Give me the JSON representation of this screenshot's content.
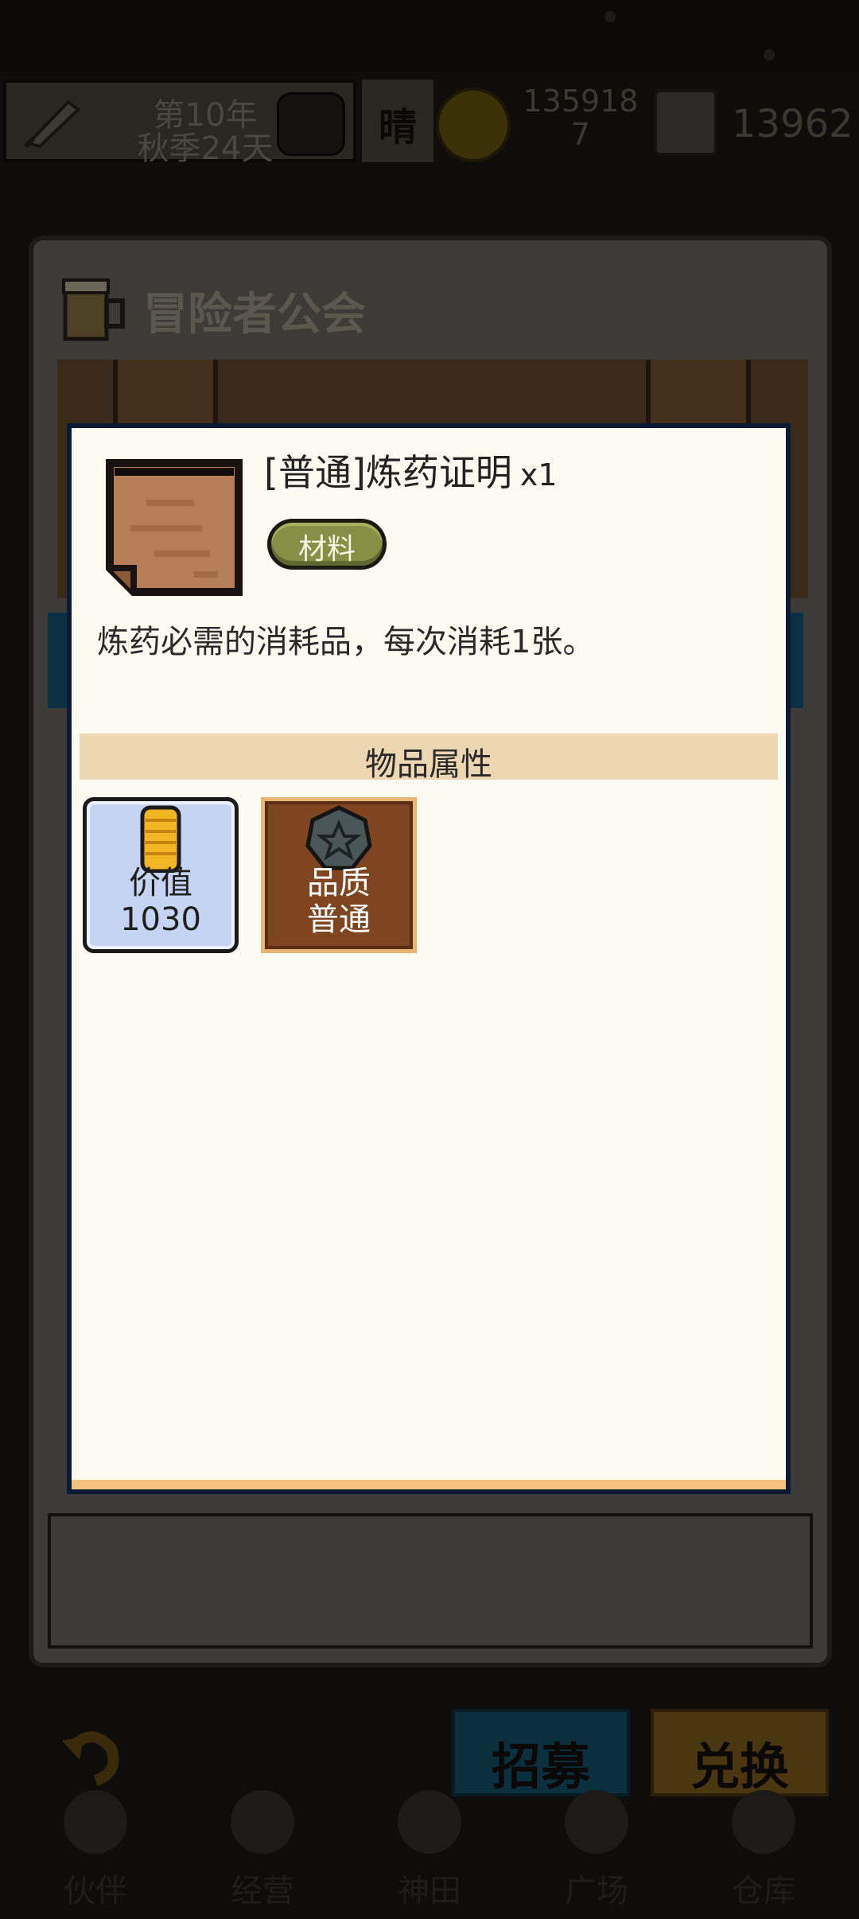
{
  "top_bar": {
    "date_line1": "第10年",
    "date_line2": "秋季24天",
    "weather": "晴",
    "gold_line1": "135918",
    "gold_line2": "7",
    "gems": "13962"
  },
  "guild": {
    "title": "冒险者公会"
  },
  "modal": {
    "item_name": "[普通]炼药证明",
    "item_count": "x1",
    "tag": "材料",
    "description": "炼药必需的消耗品，每次消耗1张。",
    "properties_header": "物品属性",
    "properties": [
      {
        "label": "价值",
        "value": "1030",
        "icon": "coin-stack-icon"
      },
      {
        "label": "品质",
        "value": "普通",
        "icon": "quality-star-icon"
      }
    ]
  },
  "bottom": {
    "recruit": "招募",
    "exchange": "兑换",
    "nav": [
      "伙伴",
      "经营",
      "神田",
      "广场",
      "仓库"
    ]
  },
  "colors": {
    "modal_border": "#0d1a33",
    "tag_green": "#859046",
    "value_card": "#c6d4f4",
    "quality_card": "#7e4520",
    "header_band": "#ecd7b2"
  }
}
